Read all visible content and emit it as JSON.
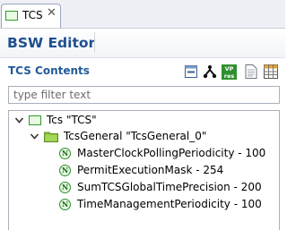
{
  "tab": {
    "label": "TCS",
    "close_glyph": "✕"
  },
  "editor": {
    "title": "BSW Editor"
  },
  "section": {
    "title": "TCS Contents"
  },
  "toolbar": [
    {
      "name": "collapse-all-icon"
    },
    {
      "name": "hierarchy-icon"
    },
    {
      "name": "vp-res-icon",
      "top_text": "VP",
      "bottom_text": "res"
    },
    {
      "name": "document-icon"
    },
    {
      "name": "table-icon"
    }
  ],
  "filter": {
    "placeholder": "type filter text",
    "value": ""
  },
  "tree": {
    "root": {
      "label": "Tcs \"TCS\"",
      "icon": "container-icon",
      "expanded": true
    },
    "group": {
      "label": "TcsGeneral \"TcsGeneral_0\"",
      "icon": "folder-icon",
      "expanded": true
    },
    "params": [
      {
        "badge": "N",
        "label": "MasterClockPollingPeriodicity - 100"
      },
      {
        "badge": "N",
        "label": "PermitExecutionMask - 254"
      },
      {
        "badge": "N",
        "label": "SumTCSGlobalTimePrecision - 200"
      },
      {
        "badge": "N",
        "label": "TimeManagementPeriodicity - 100"
      }
    ]
  },
  "colors": {
    "title": "#1f4f8f",
    "section_title": "#225a9a",
    "folder": "#8ec63f",
    "badge_border": "#2f8f2f"
  }
}
